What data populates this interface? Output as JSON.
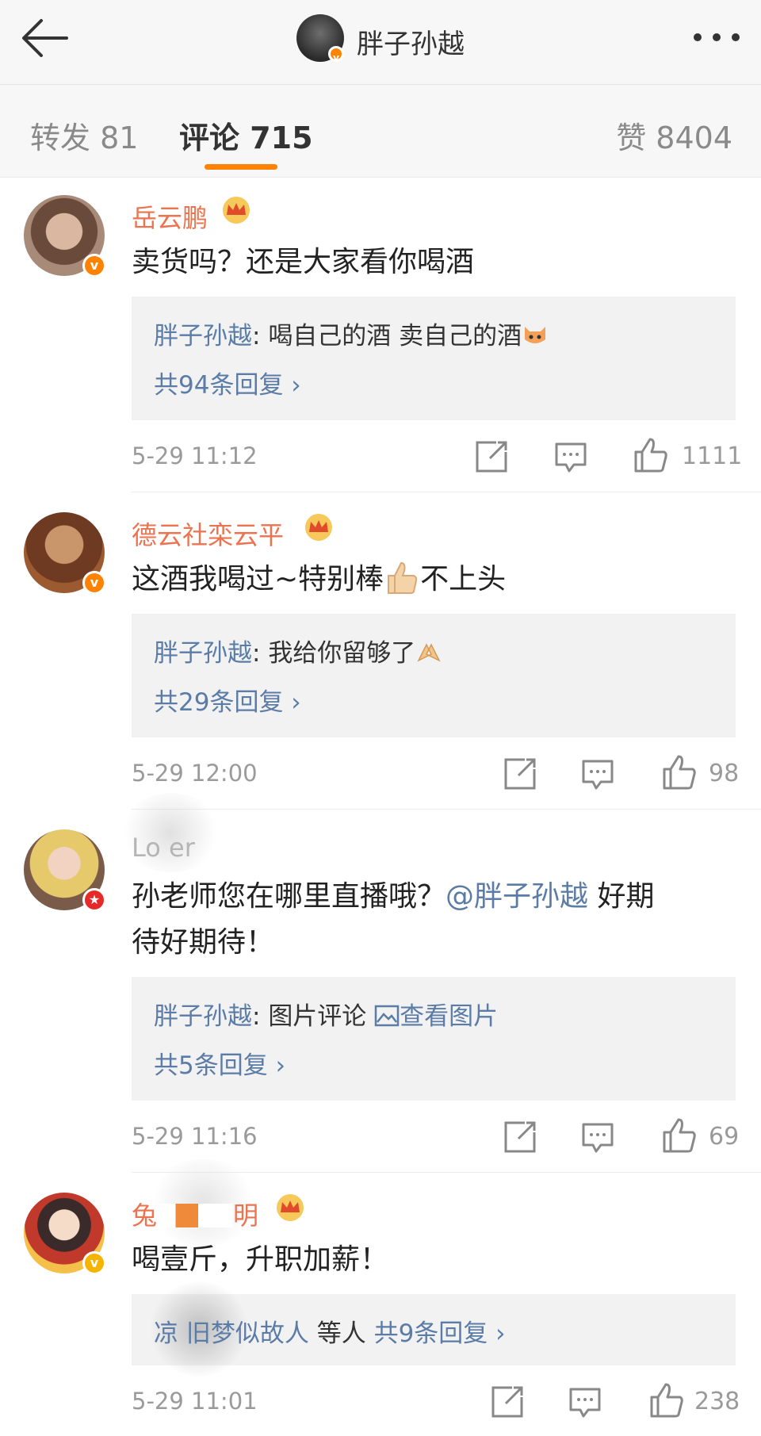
{
  "header": {
    "title": "胖子孙越",
    "back_icon": "arrow-left-icon",
    "more_icon": "more-dots-icon"
  },
  "tabs": {
    "reposts": "转发 81",
    "comments": "评论 715",
    "likes": "赞 8404"
  },
  "colors": {
    "accent": "#ff8200",
    "username": "#eb7350",
    "link": "#5b7ca7",
    "reply_bg": "#f2f2f2"
  },
  "comments": [
    {
      "username": "岳云鹏",
      "text": "卖货吗？还是大家看你喝酒",
      "reply": {
        "name": "胖子孙越",
        "sep": ": ",
        "text": "喝自己的酒 卖自己的酒"
      },
      "reply_count": "共94条回复 ›",
      "time": "5-29 11:12",
      "likes": "1111"
    },
    {
      "username": "德云社栾云平",
      "text": "这酒我喝过~特别棒",
      "text_tail": "不上头",
      "reply": {
        "name": "胖子孙越",
        "sep": ": ",
        "text": "我给你留够了"
      },
      "reply_count": "共29条回复 ›",
      "time": "5-29 12:00",
      "likes": "98"
    },
    {
      "username": "Lo   er",
      "text_part1": "孙老师您在哪里直播哦？",
      "mention": "@胖子孙越",
      "text_part2": " 好期",
      "text_line2": "待好期待！",
      "reply": {
        "name": "胖子孙越",
        "sep": ": ",
        "text": "图片评论 ",
        "link": "查看图片"
      },
      "reply_count": "共5条回复 ›",
      "time": "5-29 11:16",
      "likes": "69"
    },
    {
      "username_left": "兔",
      "username_right": "明",
      "text": "喝壹斤，升职加薪！",
      "reply_name": "凉    旧梦似故人",
      "reply_mid": " 等人 ",
      "reply_count": "共9条回复 ›",
      "time": "5-29 11:01",
      "likes": "238"
    }
  ]
}
